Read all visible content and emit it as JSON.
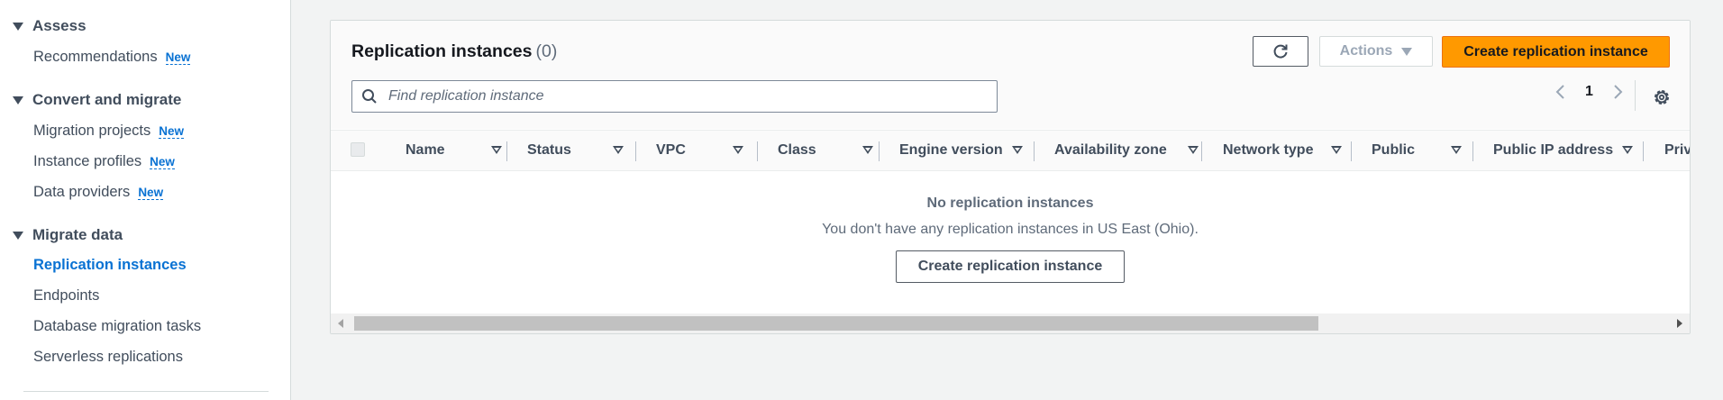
{
  "sidebar": {
    "sections": [
      {
        "label": "Assess",
        "items": [
          {
            "label": "Recommendations",
            "badge": "New"
          }
        ]
      },
      {
        "label": "Convert and migrate",
        "items": [
          {
            "label": "Migration projects",
            "badge": "New"
          },
          {
            "label": "Instance profiles",
            "badge": "New"
          },
          {
            "label": "Data providers",
            "badge": "New"
          }
        ]
      },
      {
        "label": "Migrate data",
        "items": [
          {
            "label": "Replication instances",
            "active": true
          },
          {
            "label": "Endpoints"
          },
          {
            "label": "Database migration tasks"
          },
          {
            "label": "Serverless replications"
          }
        ]
      }
    ]
  },
  "panel": {
    "title": "Replication instances",
    "count": "(0)",
    "refresh_icon": "refresh-icon",
    "actions_label": "Actions",
    "create_label": "Create replication instance",
    "search_placeholder": "Find replication instance",
    "page_number": "1",
    "columns": [
      "Name",
      "Status",
      "VPC",
      "Class",
      "Engine version",
      "Availability zone",
      "Network type",
      "Public",
      "Public IP address",
      "Priv"
    ],
    "empty_title": "No replication instances",
    "empty_desc": "You don't have any replication instances in US East (Ohio).",
    "empty_button": "Create replication instance"
  },
  "colors": {
    "primary": "#ff9900",
    "link": "#0972d3",
    "text_secondary": "#5f6b7a",
    "background": "#f2f3f3"
  }
}
